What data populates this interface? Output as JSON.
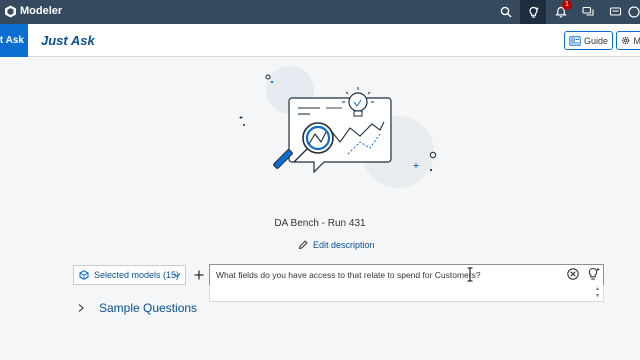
{
  "shell": {
    "app_title": "Modeler",
    "notification_count": "1"
  },
  "header": {
    "active_tab": "Just Ask",
    "page_title": "Just Ask",
    "guide_label": "Guide",
    "settings_label": "M"
  },
  "bench": {
    "name": "DA Bench - Run 431",
    "edit_label": "Edit description"
  },
  "query": {
    "models_label": "Selected models (15)",
    "question": "What fields do you have access to that relate to spend for Customers?"
  },
  "sample_questions_label": "Sample Questions",
  "colors": {
    "shell_bg": "#354a5f",
    "accent": "#0a6ed1",
    "link": "#0a4f8f",
    "badge": "#bb0000"
  }
}
